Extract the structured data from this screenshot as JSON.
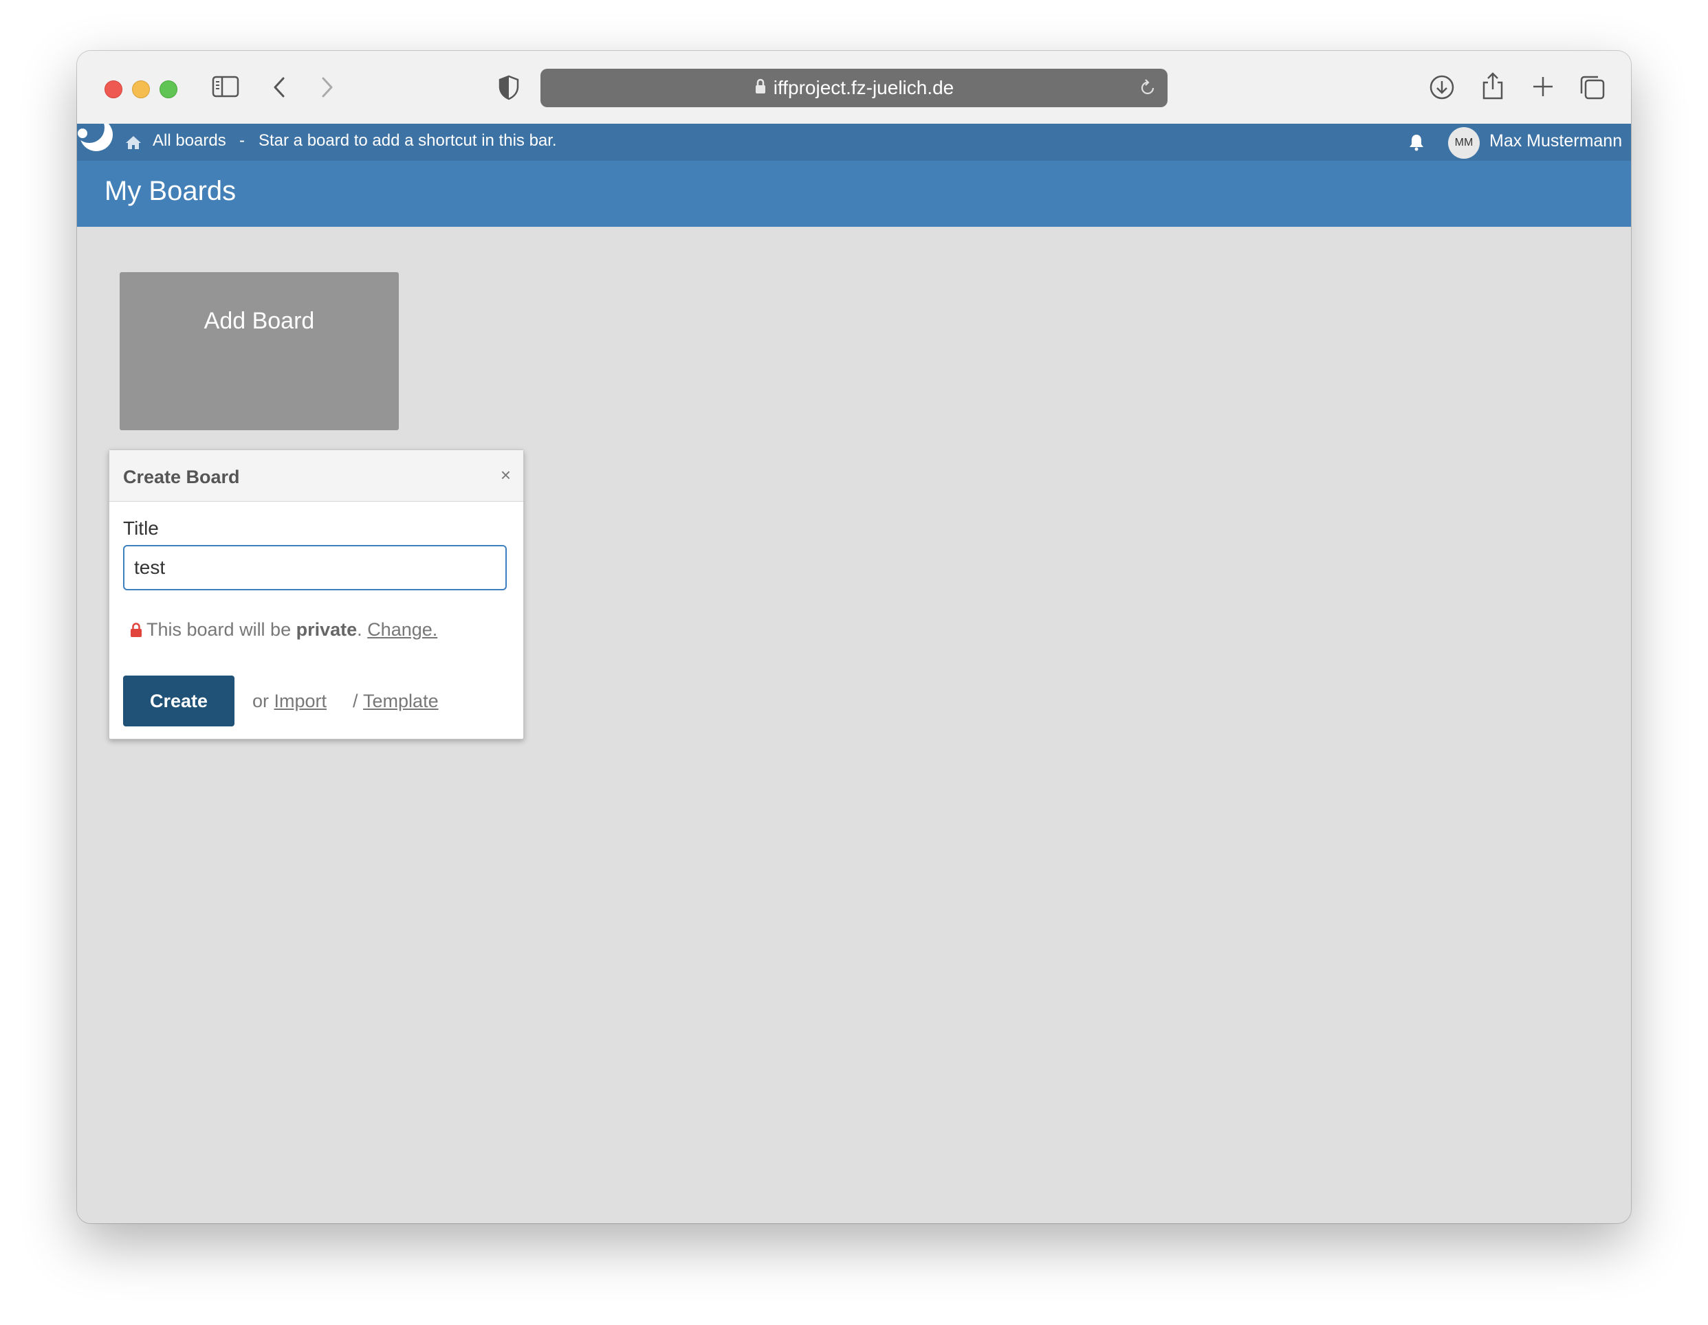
{
  "browser": {
    "url": "iffproject.fz-juelich.de"
  },
  "navbar": {
    "all_boards": "All boards",
    "separator": "-",
    "star_hint": "Star a board to add a shortcut in this bar.",
    "avatar_initials": "MM",
    "username": "Max Mustermann"
  },
  "header": {
    "title": "My Boards"
  },
  "main": {
    "add_board_label": "Add Board"
  },
  "popup": {
    "title": "Create Board",
    "close": "×",
    "title_field_label": "Title",
    "title_field_value": "test",
    "private_text_prefix": "This board will be",
    "private_word": "private",
    "private_period": ".",
    "change_link": "Change.",
    "create_button": "Create",
    "or_text": "or",
    "import_link": "Import",
    "slash_text": "/",
    "template_link": "Template"
  },
  "colors": {
    "topbar": "#3d72a4",
    "header": "#4380b7",
    "create_button": "#1f5276",
    "lock": "#e0443a"
  }
}
